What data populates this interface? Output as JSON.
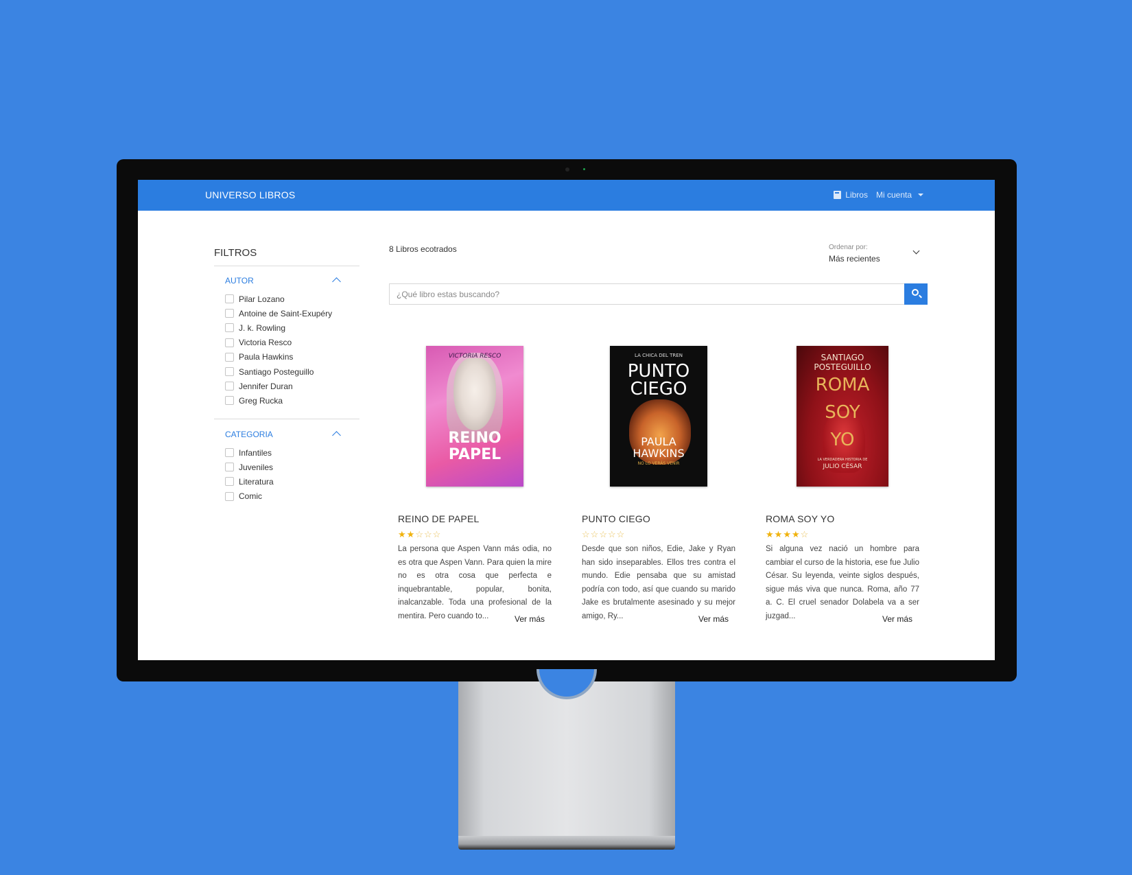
{
  "brand": "UNIVERSO LIBROS",
  "nav": {
    "books_label": "Libros",
    "account_label": "Mi cuenta"
  },
  "sidebar": {
    "title": "FILTROS",
    "author": {
      "title": "AUTOR",
      "options": [
        "Pilar Lozano",
        "Antoine de Saint-Exupéry",
        "J. k. Rowling",
        "Victoria Resco",
        "Paula Hawkins",
        "Santiago Posteguillo",
        "Jennifer Duran",
        "Greg Rucka"
      ]
    },
    "category": {
      "title": "CATEGORIA",
      "options": [
        "Infantiles",
        "Juveniles",
        "Literatura",
        "Comic"
      ]
    }
  },
  "results": {
    "count_text": "8 Libros ecotrados"
  },
  "sort": {
    "label": "Ordenar por:",
    "value": "Más recientes"
  },
  "search": {
    "placeholder": "¿Qué libro estas buscando?"
  },
  "books": [
    {
      "title": "REINO DE PAPEL",
      "rating": 2,
      "stars_max": 5,
      "description": "La persona que Aspen Vann más odia, no es otra que Aspen Vann. Para quien la mire no es otra cosa que perfecta e inquebrantable, popular, bonita, inalcanzable. Toda una profesional de la mentira. Pero cuando to...",
      "more_label": "Ver más",
      "cover": {
        "top": "VICTORIA RESCO",
        "line1": "REINO",
        "line2": "PAPEL"
      }
    },
    {
      "title": "PUNTO CIEGO",
      "rating": 0,
      "stars_max": 5,
      "description": "Desde que son niños, Edie, Jake y Ryan han sido inseparables. Ellos tres contra el mundo. Edie pensaba que su amistad podría con todo, así que cuando su marido Jake es brutalmente asesinado y su mejor amigo, Ry...",
      "more_label": "Ver más",
      "cover": {
        "top": "LA CHICA DEL TREN",
        "line1": "PUNTO",
        "line2": "CIEGO",
        "author1": "PAULA",
        "author2": "HAWKINS",
        "tag": "NO LO VERÁS VENIR"
      }
    },
    {
      "title": "ROMA SOY YO",
      "rating": 4,
      "stars_max": 5,
      "description": "Si alguna vez nació un hombre para cambiar el curso de la historia, ese fue Julio César. Su leyenda, veinte siglos después, sigue más viva que nunca. Roma, año 77 a. C. El cruel senador Dolabela va a ser juzgad...",
      "more_label": "Ver más",
      "cover": {
        "author1": "SANTIAGO",
        "author2": "POSTEGUILLO",
        "line1": "ROMA",
        "line2": "SOY",
        "line3": "YO",
        "tag1": "LA VERDADERA HISTORIA DE",
        "tag2": "JULIO CÉSAR"
      }
    }
  ],
  "colors": {
    "background": "#3b84e2",
    "navbar": "#2b7de0",
    "star": "#f0b20c"
  }
}
